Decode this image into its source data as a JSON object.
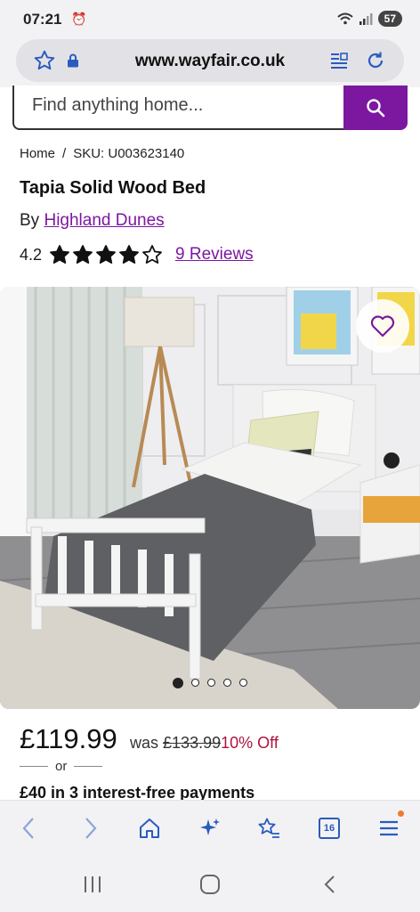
{
  "status": {
    "time": "07:21",
    "battery": "57"
  },
  "browser": {
    "url": "www.wayfair.co.uk",
    "tab_count": "16"
  },
  "search": {
    "placeholder": "Find anything home..."
  },
  "breadcrumb": {
    "home": "Home",
    "separator": "/",
    "sku": "SKU: U003623140"
  },
  "product": {
    "title": "Tapia Solid Wood Bed",
    "by_label": "By",
    "brand": "Highland Dunes",
    "rating": "4.2",
    "stars_filled": 4,
    "stars_total": 5,
    "reviews": "9 Reviews",
    "image_count": 5,
    "image_active": 1
  },
  "pricing": {
    "price": "£119.99",
    "was_label": "was",
    "was_price": "£133.99",
    "discount": "10% Off",
    "or_label": "or",
    "installments": "£40 in 3 interest-free payments"
  },
  "colors": {
    "brand_purple": "#7b189f",
    "discount_red": "#b0123c"
  }
}
